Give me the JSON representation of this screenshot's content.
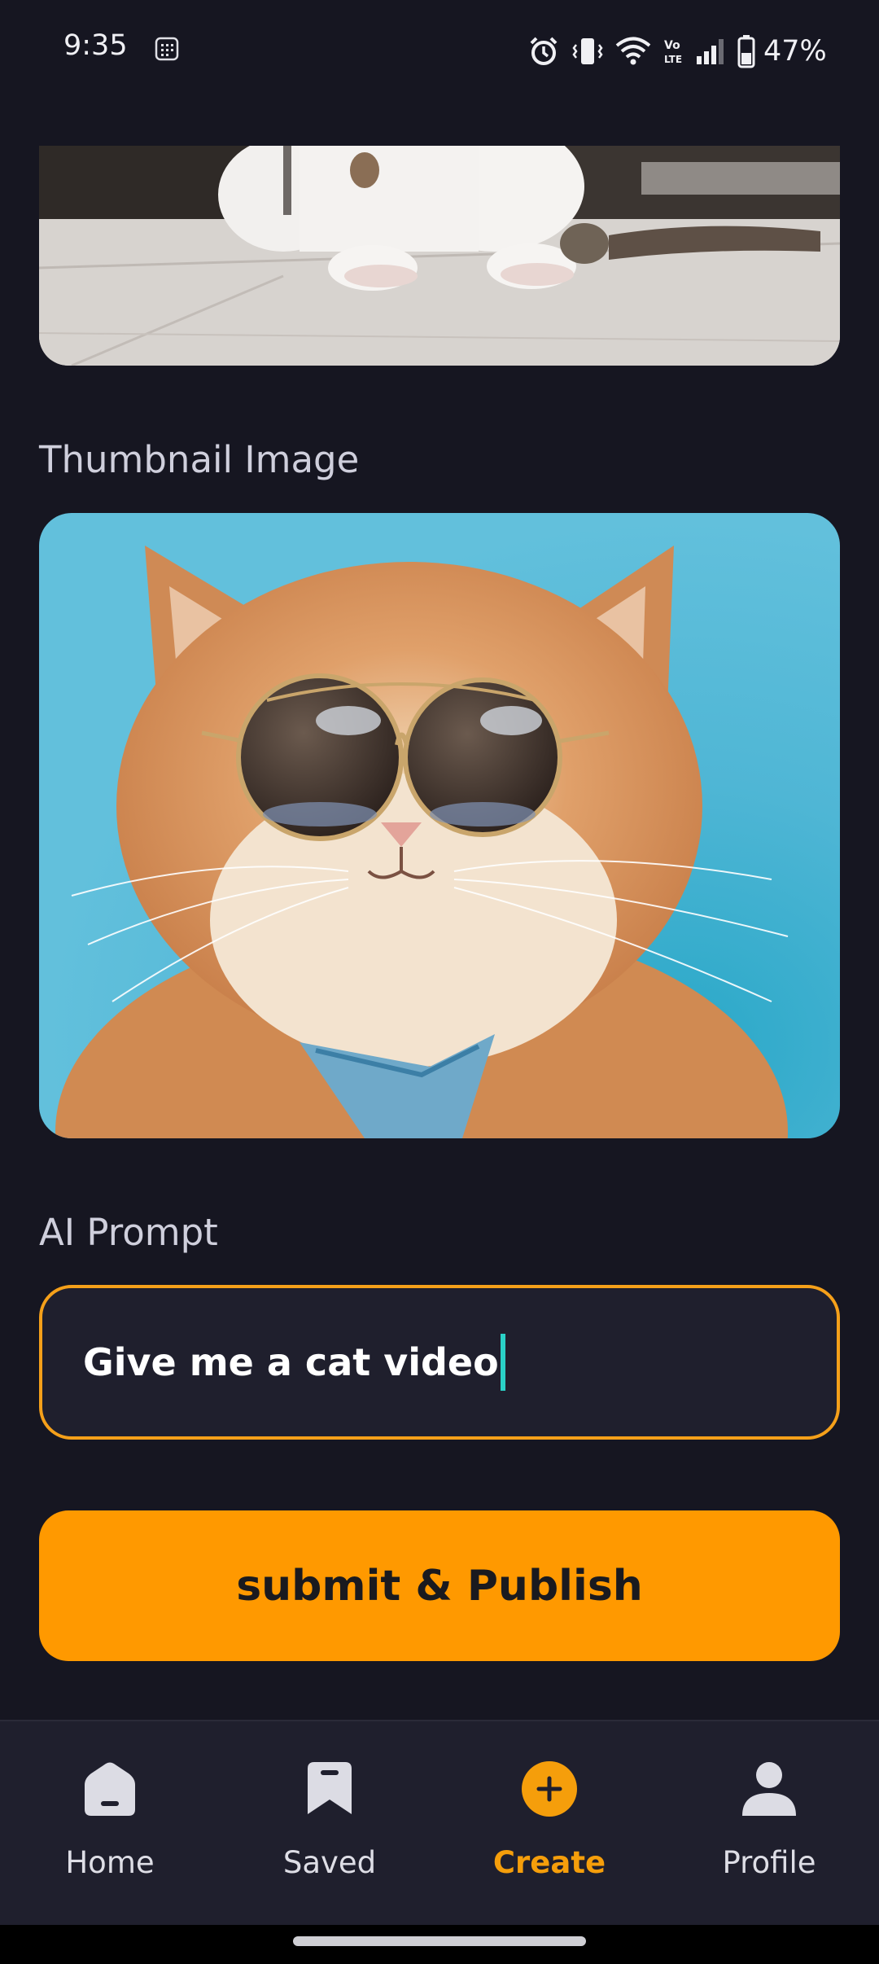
{
  "status_bar": {
    "time": "9:35",
    "battery_text": "47%",
    "icons": [
      "notes-icon",
      "alarm-icon",
      "vibrate-icon",
      "wifi-icon",
      "volte-icon",
      "signal-icon",
      "battery-icon"
    ]
  },
  "sections": {
    "thumbnail_label": "Thumbnail Image",
    "prompt_label": "AI Prompt"
  },
  "prompt": {
    "value": "Give me a cat video"
  },
  "submit": {
    "label": "submit & Publish"
  },
  "nav": {
    "items": [
      {
        "label": "Home",
        "icon": "home-icon"
      },
      {
        "label": "Saved",
        "icon": "bookmark-icon"
      },
      {
        "label": "Create",
        "icon": "plus-circle-icon"
      },
      {
        "label": "Profile",
        "icon": "person-icon"
      }
    ],
    "active": "Create"
  },
  "colors": {
    "background": "#161621",
    "accent": "#ff9900",
    "input_border": "#f5a01a",
    "caret": "#2ad1c7"
  }
}
